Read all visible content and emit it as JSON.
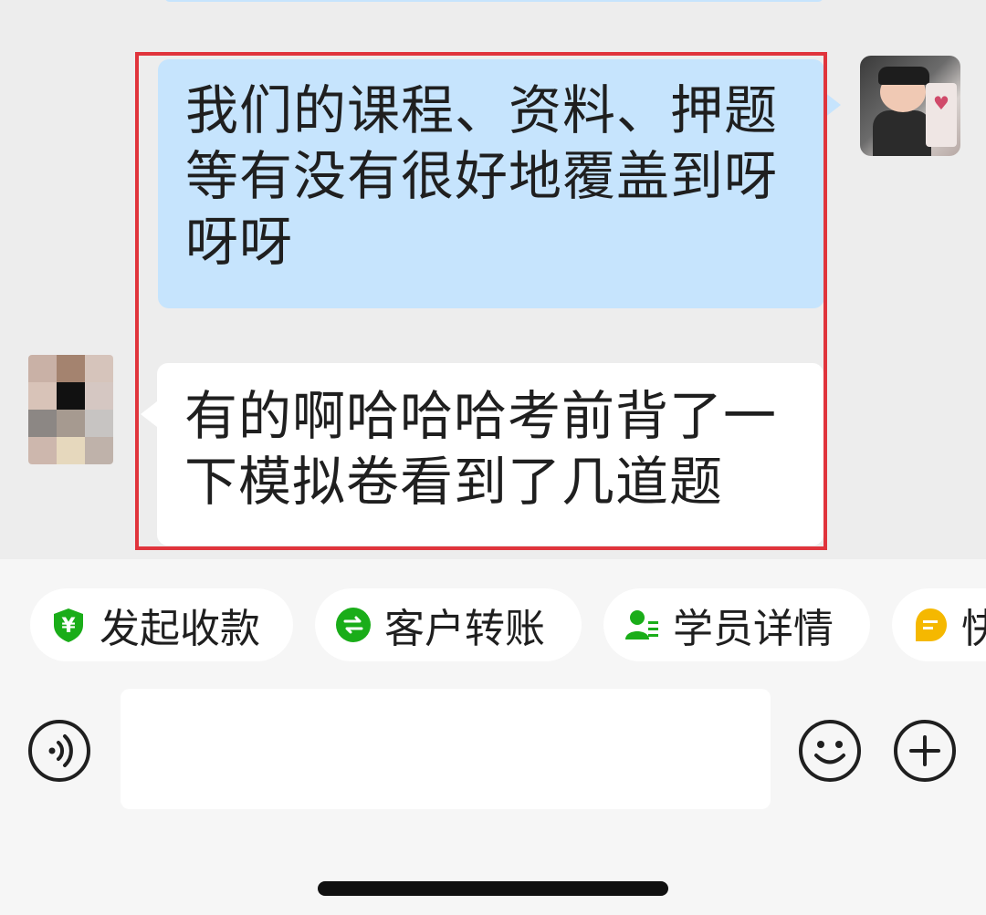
{
  "messages": [
    {
      "sender": "me",
      "text": "我们的课程、资料、押题等有没有很好地覆盖到呀呀呀"
    },
    {
      "sender": "other",
      "text": "有的啊哈哈哈考前背了一下模拟卷看到了几道题"
    }
  ],
  "quick_actions": [
    {
      "label": "发起收款",
      "icon": "yuan-shield-icon",
      "color": "#1aad19"
    },
    {
      "label": "客户转账",
      "icon": "transfer-icon",
      "color": "#1aad19"
    },
    {
      "label": "学员详情",
      "icon": "student-card-icon",
      "color": "#1aad19"
    },
    {
      "label": "快",
      "icon": "quick-reply-icon",
      "color": "#f5b800"
    }
  ],
  "input": {
    "value": "",
    "placeholder": ""
  },
  "colors": {
    "my_bubble": "#c6e4fd",
    "other_bubble": "#ffffff",
    "highlight_border": "#e0343c",
    "accent_green": "#1aad19"
  },
  "icons": {
    "voice": "voice-icon",
    "emoji": "emoji-icon",
    "plus": "plus-icon"
  }
}
